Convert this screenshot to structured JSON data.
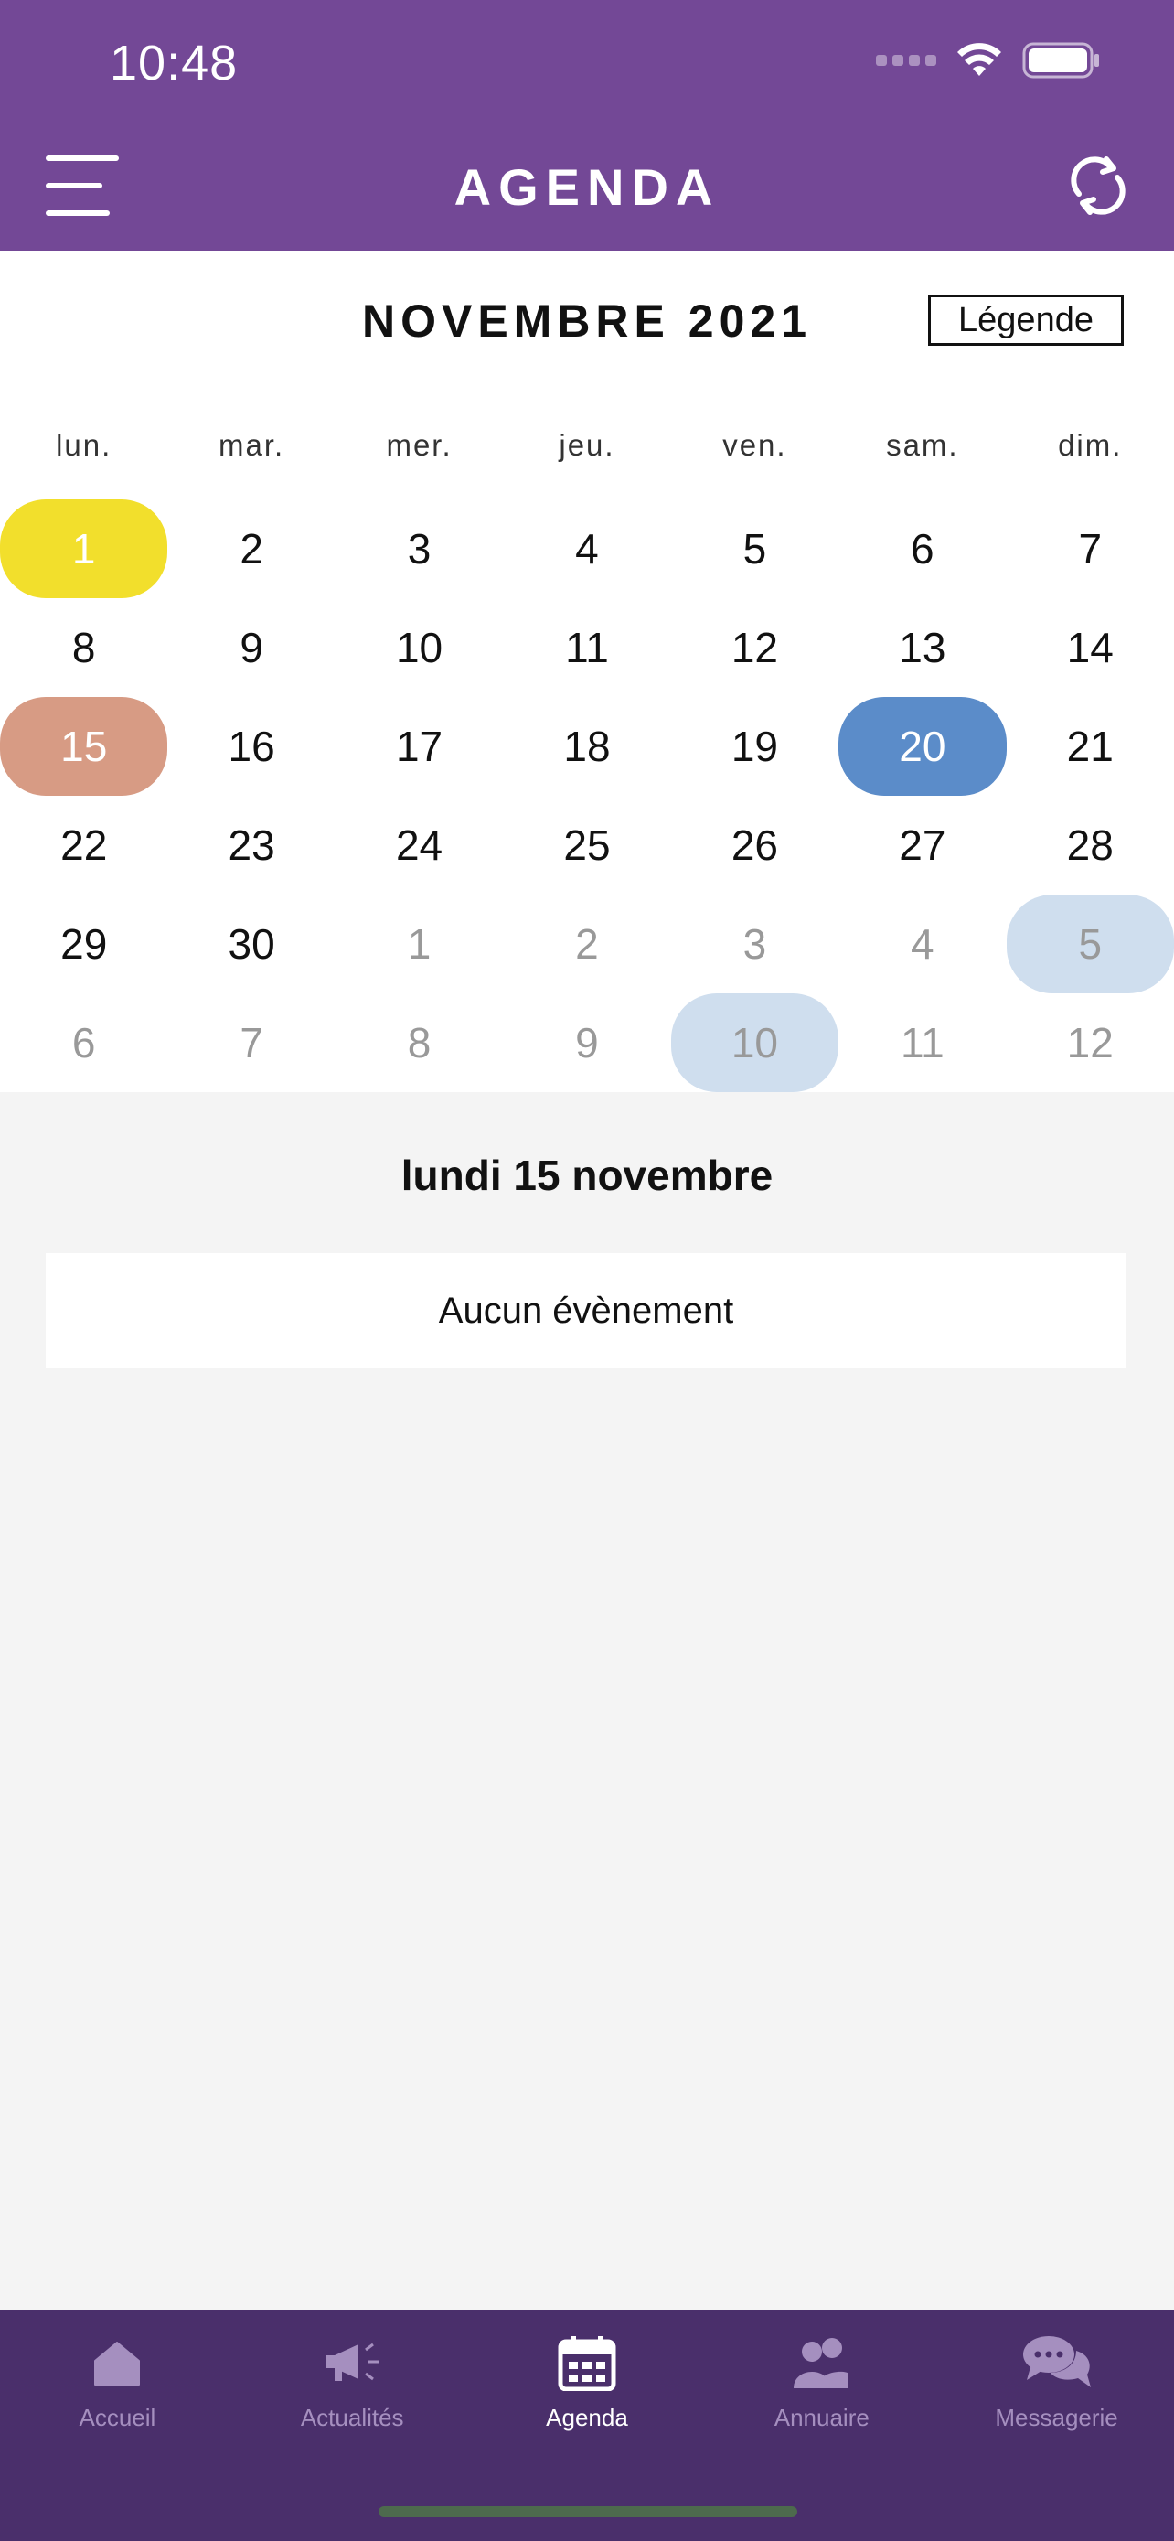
{
  "status_bar": {
    "time": "10:48"
  },
  "header": {
    "title": "AGENDA"
  },
  "calendar": {
    "month_title": "NOVEMBRE 2021",
    "legend_label": "Légende",
    "weekdays": [
      "lun.",
      "mar.",
      "mer.",
      "jeu.",
      "ven.",
      "sam.",
      "dim."
    ],
    "weeks": [
      [
        "1",
        "2",
        "3",
        "4",
        "5",
        "6",
        "7"
      ],
      [
        "8",
        "9",
        "10",
        "11",
        "12",
        "13",
        "14"
      ],
      [
        "15",
        "16",
        "17",
        "18",
        "19",
        "20",
        "21"
      ],
      [
        "22",
        "23",
        "24",
        "25",
        "26",
        "27",
        "28"
      ],
      [
        "29",
        "30",
        "1",
        "2",
        "3",
        "4",
        "5"
      ],
      [
        "6",
        "7",
        "8",
        "9",
        "10",
        "11",
        "12"
      ]
    ],
    "colors": {
      "yellow": "#f2df2c",
      "salmon": "#d79b84",
      "blue": "#5b8cc9",
      "light_blue": "#cfdeee"
    }
  },
  "selected_day": {
    "label": "lundi 15 novembre",
    "empty_message": "Aucun évènement"
  },
  "tabbar": {
    "items": [
      {
        "label": "Accueil",
        "icon": "home-icon"
      },
      {
        "label": "Actualités",
        "icon": "megaphone-icon"
      },
      {
        "label": "Agenda",
        "icon": "calendar-icon",
        "active": true
      },
      {
        "label": "Annuaire",
        "icon": "people-icon"
      },
      {
        "label": "Messagerie",
        "icon": "chat-icon"
      }
    ]
  },
  "theme": {
    "primary": "#734896",
    "tabbar": "#4a2f6b"
  }
}
